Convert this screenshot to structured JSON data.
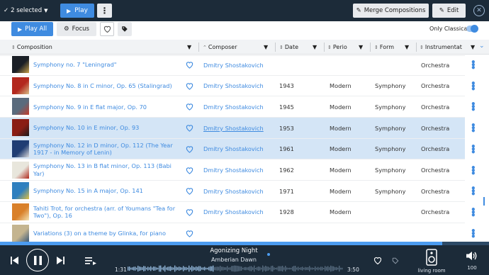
{
  "selection": {
    "count_label": "2 selected",
    "play_label": "Play",
    "merge_label": "Merge Compositions",
    "edit_label": "Edit"
  },
  "toolbar": {
    "play_all_label": "Play All",
    "focus_label": "Focus",
    "only_classical_label": "Only Classical",
    "only_classical_on": true
  },
  "columns": {
    "composition": "Composition",
    "composer": "Composer",
    "date": "Date",
    "period": "Perio",
    "form": "Form",
    "instrumentation": "Instrumentat"
  },
  "rows": [
    {
      "title": "Symphony no. 7 \"Leningrad\"",
      "composer": "Dmitry Shostakovich",
      "date": "",
      "period": "",
      "form": "",
      "instr": "Orchestra",
      "selected": false,
      "cover": [
        "#1a1f26",
        "#c9a14a"
      ]
    },
    {
      "title": "Symphony No. 8 in C minor, Op. 65 (Stalingrad)",
      "composer": "Dmitry Shostakovich",
      "date": "1943",
      "period": "Modern",
      "form": "Symphony",
      "instr": "Orchestra",
      "selected": false,
      "cover": [
        "#b3281e",
        "#d8c08a"
      ]
    },
    {
      "title": "Symphony No. 9 in E flat major, Op. 70",
      "composer": "Dmitry Shostakovich",
      "date": "1945",
      "period": "Modern",
      "form": "Symphony",
      "instr": "Orchestra",
      "selected": false,
      "cover": [
        "#5a6b7d",
        "#c43c2a"
      ]
    },
    {
      "title": "Symphony No. 10 in E minor, Op. 93",
      "composer": "Dmitry Shostakovich",
      "date": "1953",
      "period": "Modern",
      "form": "Symphony",
      "instr": "Orchestra",
      "selected": true,
      "cover": [
        "#8a1d14",
        "#1b1b1b"
      ]
    },
    {
      "title": "Symphony No. 12 in D minor, Op. 112 (The Year 1917 - in Memory of Lenin)",
      "composer": "Dmitry Shostakovich",
      "date": "1961",
      "period": "Modern",
      "form": "Symphony",
      "instr": "Orchestra",
      "selected": true,
      "cover": [
        "#1f3d73",
        "#d8d8d8"
      ]
    },
    {
      "title": "Symphony No. 13 in B flat minor, Op. 113 (Babi Yar)",
      "composer": "Dmitry Shostakovich",
      "date": "1962",
      "period": "Modern",
      "form": "Symphony",
      "instr": "Orchestra",
      "selected": false,
      "cover": [
        "#e8e6dc",
        "#b02a1d"
      ]
    },
    {
      "title": "Symphony No. 15 in A major, Op. 141",
      "composer": "Dmitry Shostakovich",
      "date": "1971",
      "period": "Modern",
      "form": "Symphony",
      "instr": "Orchestra",
      "selected": false,
      "cover": [
        "#2e7fbf",
        "#e0c040"
      ]
    },
    {
      "title": "Tahiti Trot, for orchestra (arr. of Youmans \"Tea for Two\"), Op. 16",
      "composer": "Dmitry Shostakovich",
      "date": "1928",
      "period": "Modern",
      "form": "",
      "instr": "Orchestra",
      "selected": false,
      "cover": [
        "#d9802a",
        "#f2e3b5"
      ]
    },
    {
      "title": "Variations (3) on a theme by Glinka, for piano",
      "composer": "",
      "date": "",
      "period": "",
      "form": "",
      "instr": "",
      "selected": false,
      "cover": [
        "#c4b48f",
        "#3a5a7a"
      ]
    }
  ],
  "player": {
    "track": "Agonizing Night",
    "artist": "Amberian Dawn",
    "elapsed": "1:31",
    "total": "3:50",
    "progress": 0.905,
    "room": "living room",
    "volume": "100"
  },
  "colors": {
    "accent": "#3f8be0",
    "bar_bg": "#1c2b39",
    "selected_row": "#d4e5f6"
  }
}
